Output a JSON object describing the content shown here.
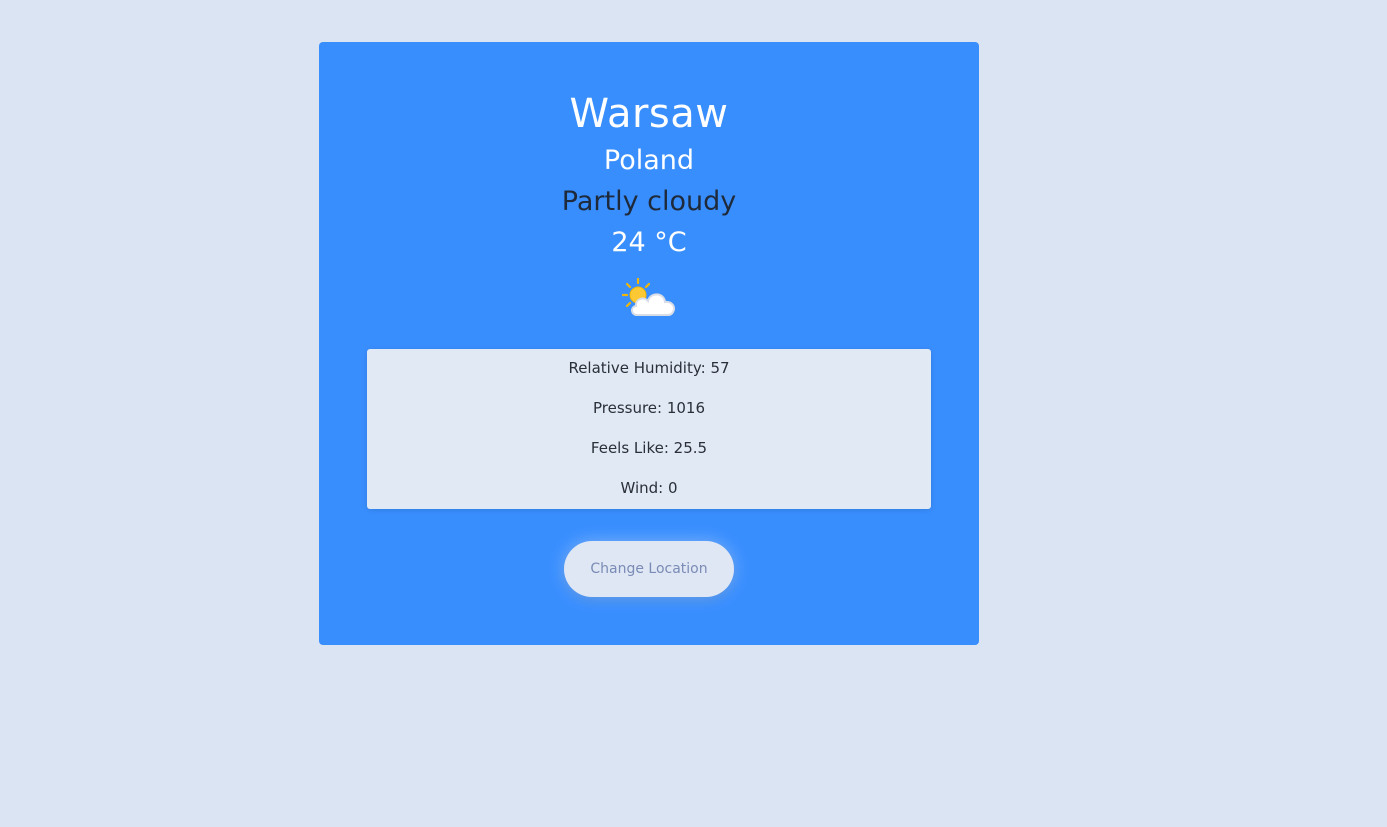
{
  "weather": {
    "city": "Warsaw",
    "country": "Poland",
    "condition": "Partly cloudy",
    "temperature": "24 °C",
    "icon": "partly-cloudy-icon"
  },
  "details": [
    {
      "text": "Relative Humidity: 57"
    },
    {
      "text": "Pressure: 1016"
    },
    {
      "text": "Feels Like: 25.5"
    },
    {
      "text": "Wind: 0"
    }
  ],
  "actions": {
    "change_location_label": "Change Location"
  },
  "colors": {
    "page_background": "#dae4f2",
    "card_background": "#398efe",
    "details_background": "#e1e9f5",
    "button_background": "#dfe7f5",
    "button_text": "#7a8bb5"
  }
}
